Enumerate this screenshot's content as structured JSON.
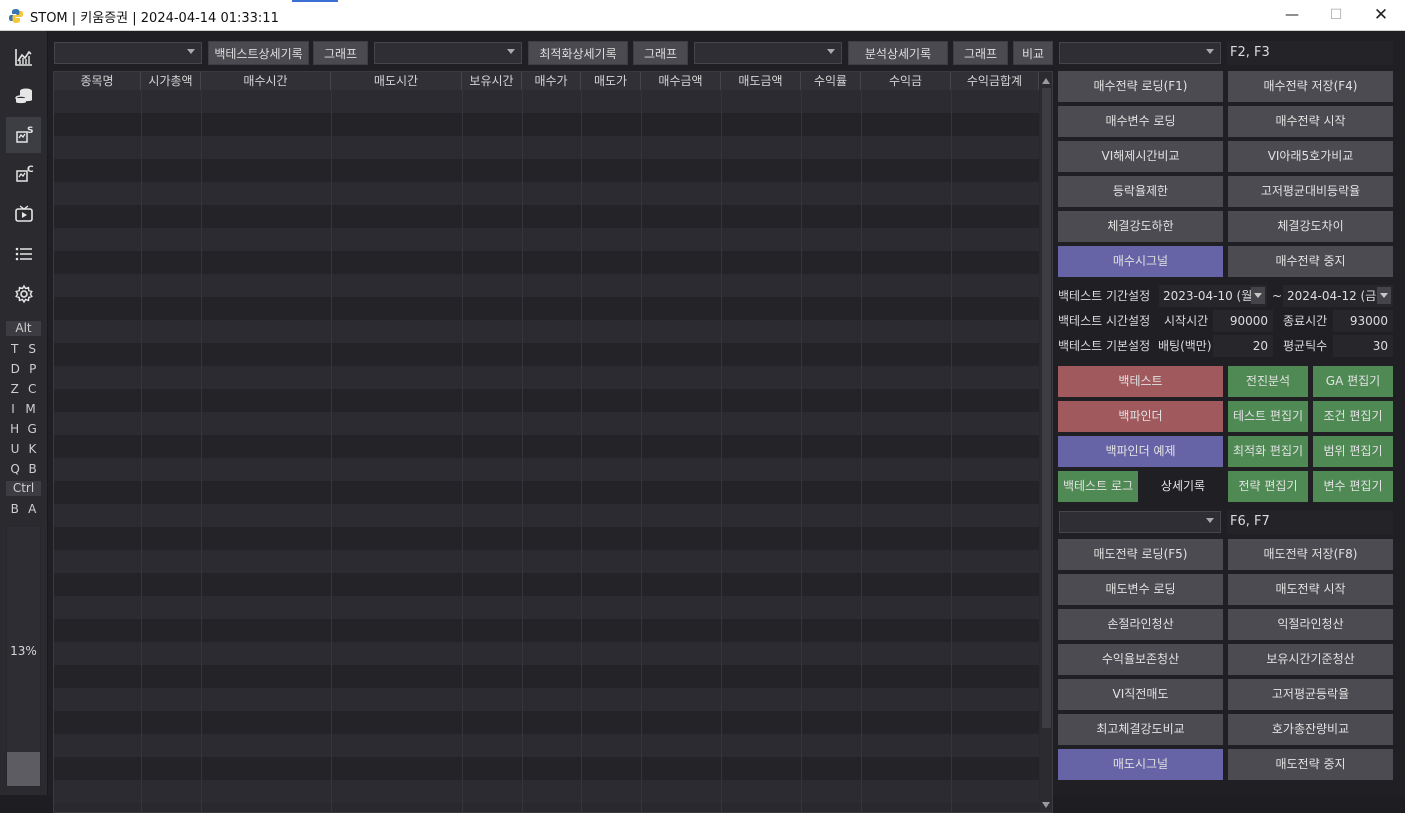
{
  "window": {
    "title": "STOM | 키움증권 | 2024-04-14 01:33:11",
    "minimize": "—",
    "maximize": "☐",
    "close": "✕"
  },
  "sidebar": {
    "icons": [
      "chart-icon",
      "database-icon",
      "strategy-s-icon",
      "strategy-c-icon",
      "video-icon",
      "list-icon",
      "gear-icon"
    ],
    "alt_header": "Alt",
    "alt_keys": [
      [
        "T",
        "S"
      ],
      [
        "D",
        "P"
      ],
      [
        "Z",
        "C"
      ],
      [
        "I",
        "M"
      ],
      [
        "H",
        "G"
      ],
      [
        "U",
        "K"
      ],
      [
        "Q",
        "B"
      ]
    ],
    "ctrl_header": "Ctrl",
    "ctrl_keys": [
      [
        "B",
        "A"
      ]
    ],
    "progress_percent": 13,
    "progress_label": "13%"
  },
  "toolbar": {
    "backtest_detail_label": "백테스트상세기록",
    "graph1_label": "그래프",
    "optimize_detail_label": "최적화상세기록",
    "graph2_label": "그래프",
    "analysis_detail_label": "분석상세기록",
    "graph3_label": "그래프",
    "compare_label": "비교"
  },
  "table": {
    "columns": [
      "종목명",
      "시가총액",
      "매수시간",
      "매도시간",
      "보유시간",
      "매수가",
      "매도가",
      "매수금액",
      "매도금액",
      "수익률",
      "수익금",
      "수익금합계"
    ],
    "row_count": 31
  },
  "buy_panel": {
    "fkeys": "F2, F3",
    "buttons": [
      "매수전략 로딩(F1)",
      "매수전략 저장(F4)",
      "매수변수 로딩",
      "매수전략 시작",
      "VI해제시간비교",
      "VI아래5호가비교",
      "등락율제한",
      "고저평균대비등락율",
      "체결강도하한",
      "체결강도차이",
      "매수시그널",
      "매수전략 중지"
    ]
  },
  "backtest_settings": {
    "period_label": "백테스트 기간설정",
    "start_date": "2023-04-10 (월)",
    "tilde": "~",
    "end_date": "2024-04-12 (금)",
    "time_label": "백테스트 시간설정",
    "start_time_label": "시작시간",
    "start_time": "90000",
    "end_time_label": "종료시간",
    "end_time": "93000",
    "basic_label": "백테스트 기본설정",
    "betting_label": "배팅(백만)",
    "betting": "20",
    "avg_tick_label": "평균틱수",
    "avg_tick": "30"
  },
  "backtest_actions": {
    "backtest": "백테스트",
    "forward_analysis": "전진분석",
    "ga_editor": "GA 편집기",
    "backfinder": "백파인더",
    "test_editor": "테스트 편집기",
    "condition_editor": "조건 편집기",
    "backfinder_example": "백파인더 예제",
    "optimize_editor": "최적화 편집기",
    "range_editor": "범위 편집기",
    "backtest_log": "백테스트 로그",
    "detail_record": "상세기록",
    "strategy_editor": "전략 편집기",
    "variable_editor": "변수 편집기"
  },
  "sell_panel": {
    "fkeys": "F6, F7",
    "buttons": [
      "매도전략 로딩(F5)",
      "매도전략 저장(F8)",
      "매도변수 로딩",
      "매도전략 시작",
      "손절라인청산",
      "익절라인청산",
      "수익율보존청산",
      "보유시간기준청산",
      "VI직전매도",
      "고저평균등락율",
      "최고체결강도비교",
      "호가총잔량비교",
      "매도시그널",
      "매도전략 중지"
    ]
  }
}
